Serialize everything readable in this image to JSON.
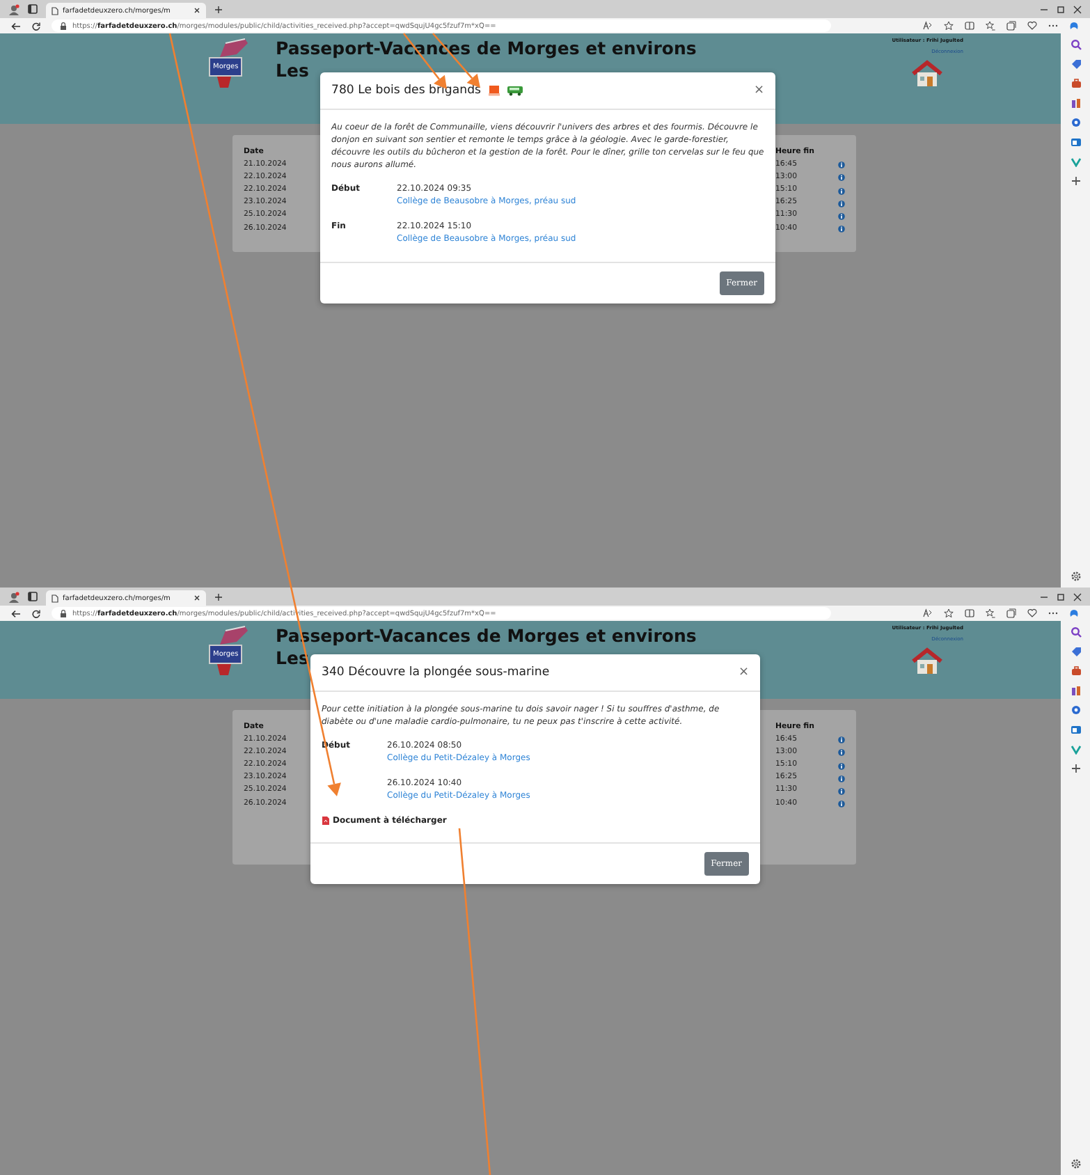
{
  "panes": [
    {
      "browser": {
        "tab_title": "farfadetdeuxzero.ch/morges/m",
        "url": "https://**farfadetdeuxzero.ch**/morges/modules/public/child/activities_received.php?accept=qwdSqujU4gc5fzuf7m*xQ=="
      },
      "site": {
        "logo_text": "Morges",
        "title": "Passeport-Vacances de Morges et environs",
        "subtitle": "Les",
        "user": "Utilisateur : Frihi Jugulted",
        "logout": "Déconnexion",
        "table": {
          "columns": [
            "Date",
            "Heure fin"
          ],
          "rows": [
            {
              "date": "21.10.2024",
              "end": "16:45"
            },
            {
              "date": "22.10.2024",
              "end": "13:00"
            },
            {
              "date": "22.10.2024",
              "end": "15:10"
            },
            {
              "date": "23.10.2024",
              "end": "16:25"
            },
            {
              "date": "25.10.2024",
              "end": "11:30"
            },
            {
              "date": "26.10.2024",
              "end": "10:40"
            }
          ]
        }
      },
      "modal": {
        "title": "780 Le bois des brigands",
        "badges": [
          {
            "kind": "screen"
          },
          {
            "kind": "bus"
          }
        ],
        "close": "×",
        "description": "Au coeur de la forêt de Communaille, viens découvrir l'univers des arbres et des fourmis. Découvre le donjon en suivant son sentier et remonte le temps grâce à la géologie. Avec le garde-forestier, découvre les outils du bûcheron et la gestion de la forêt. Pour le dîner, grille ton cervelas sur le feu que nous aurons allumé.",
        "times": [
          {
            "label": "Début",
            "datetime": "22.10.2024 09:35",
            "place": "Collège de Beausobre à Morges, préau sud"
          },
          {
            "label": "Fin",
            "datetime": "22.10.2024 15:10",
            "place": "Collège de Beausobre à Morges, préau sud"
          }
        ],
        "button": "Fermer"
      }
    },
    {
      "browser": {
        "tab_title": "farfadetdeuxzero.ch/morges/m",
        "url": "https://**farfadetdeuxzero.ch**/morges/modules/public/child/activities_received.php?accept=qwdSqujU4gc5fzuf7m*xQ=="
      },
      "site": {
        "logo_text": "Morges",
        "title": "Passeport-Vacances de Morges et environs",
        "subtitle": "Les",
        "user": "Utilisateur : Frihi Jugulted",
        "logout": "Déconnexion",
        "table": {
          "columns": [
            "Date",
            "Heure fin"
          ],
          "rows": [
            {
              "date": "21.10.2024",
              "end": "16:45"
            },
            {
              "date": "22.10.2024",
              "end": "13:00"
            },
            {
              "date": "22.10.2024",
              "end": "15:10"
            },
            {
              "date": "23.10.2024",
              "end": "16:25"
            },
            {
              "date": "25.10.2024",
              "end": "11:30"
            },
            {
              "date": "26.10.2024",
              "end": "10:40"
            }
          ]
        }
      },
      "modal": {
        "title": "340 Découvre la plongée sous-marine",
        "close": "×",
        "description": "Pour cette initiation à la plongée sous-marine tu dois savoir nager ! Si tu souffres d'asthme, de diabète ou d'une maladie cardio-pulmonaire, tu ne peux pas t'inscrire à cette activité.",
        "times": [
          {
            "label": "Début",
            "datetime": "26.10.2024 08:50",
            "place": "Collège du Petit-Dézaley à Morges"
          },
          {
            "datetime": "26.10.2024 10:40",
            "place": "Collège du Petit-Dézaley à Morges"
          }
        ],
        "document": "Document à télécharger",
        "button": "Fermer"
      }
    }
  ]
}
